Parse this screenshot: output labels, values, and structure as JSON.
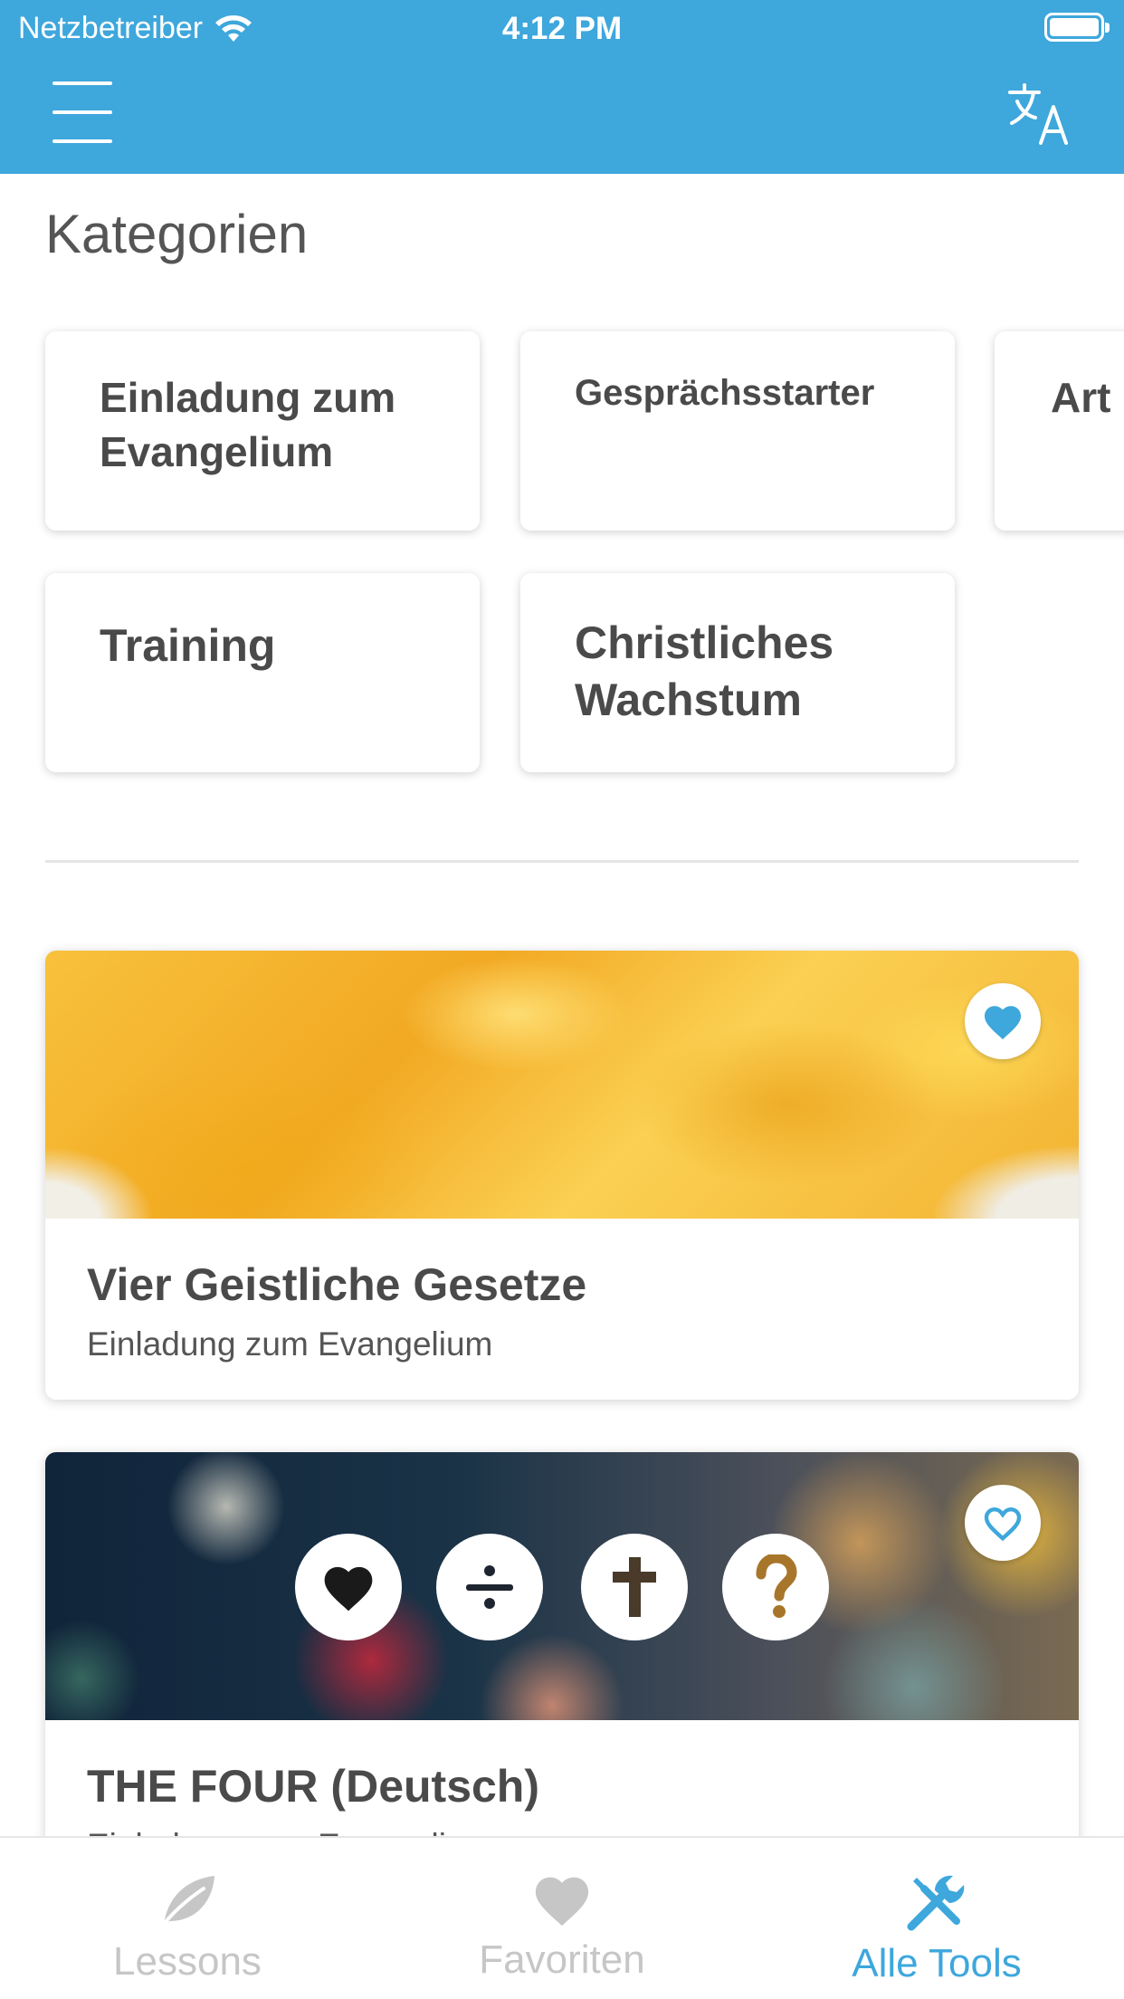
{
  "status_bar": {
    "carrier": "Netzbetreiber",
    "time": "4:12 PM"
  },
  "nav": {
    "menu_icon": "hamburger-menu-icon",
    "language_icon": "translate-icon"
  },
  "categories": {
    "title": "Kategorien",
    "items": [
      {
        "label": "Einladung zum Evangelium"
      },
      {
        "label": "Gesprächsstarter"
      },
      {
        "label": "Art"
      },
      {
        "label": "Training"
      },
      {
        "label": "Christliches Wachstum"
      }
    ]
  },
  "tools": [
    {
      "title": "Vier Geistliche Gesetze",
      "category": "Einladung zum Evangelium",
      "favorited": true
    },
    {
      "title": "THE FOUR (Deutsch)",
      "category": "Einladung zum Evangelium",
      "favorited": false
    }
  ],
  "tabbar": {
    "tabs": [
      {
        "label": "Lessons",
        "icon": "leaf-icon",
        "active": false
      },
      {
        "label": "Favoriten",
        "icon": "heart-icon",
        "active": false
      },
      {
        "label": "Alle Tools",
        "icon": "tools-icon",
        "active": true
      }
    ]
  },
  "colors": {
    "primary": "#3ea7dc",
    "inactive": "#c6c6c6",
    "text": "#4a4a4a"
  }
}
